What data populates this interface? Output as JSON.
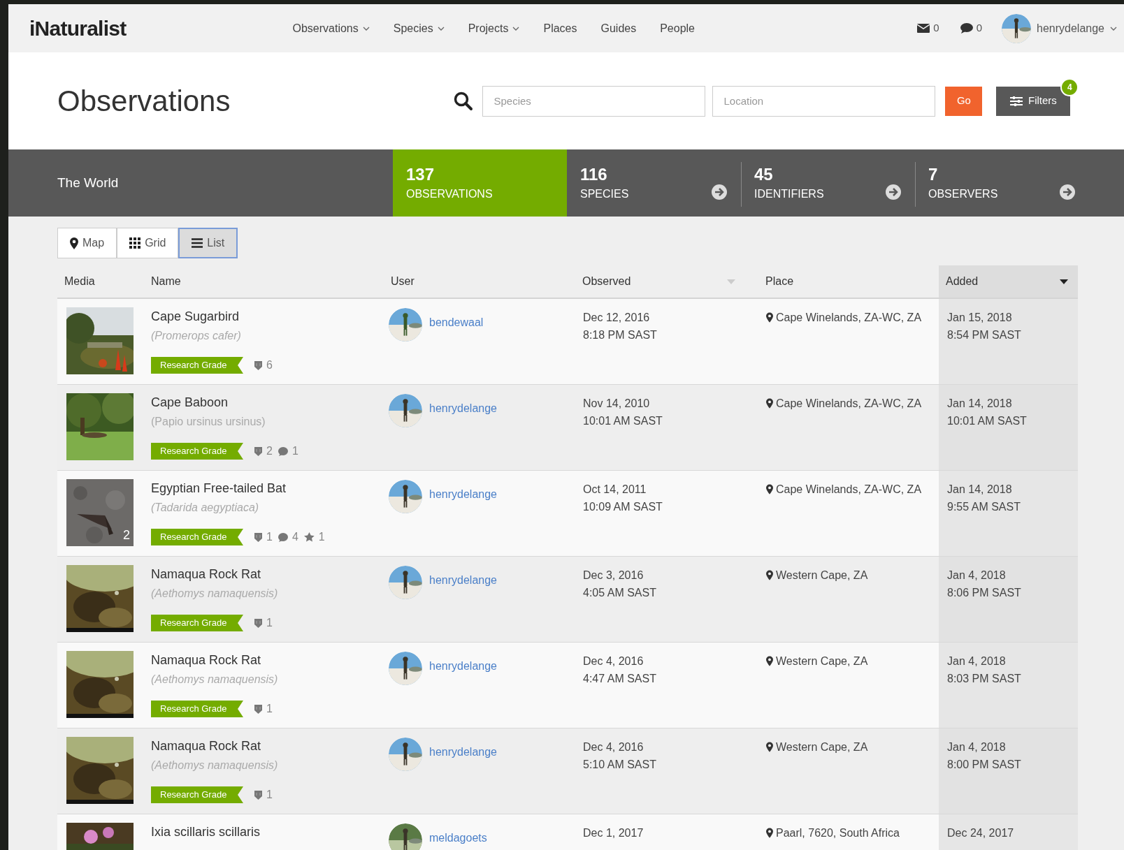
{
  "nav": {
    "logo": "iNaturalist",
    "items": [
      {
        "label": "Observations",
        "dropdown": true
      },
      {
        "label": "Species",
        "dropdown": true
      },
      {
        "label": "Projects",
        "dropdown": true
      },
      {
        "label": "Places",
        "dropdown": false
      },
      {
        "label": "Guides",
        "dropdown": false
      },
      {
        "label": "People",
        "dropdown": false
      }
    ],
    "messages": "0",
    "notifications": "0",
    "user": "henrydelange"
  },
  "header": {
    "title": "Observations",
    "species_placeholder": "Species",
    "location_placeholder": "Location",
    "go": "Go",
    "filters": "Filters",
    "filters_count": "4"
  },
  "stats": {
    "place": "The World",
    "tabs": [
      {
        "count": "137",
        "label": "OBSERVATIONS",
        "selected": true
      },
      {
        "count": "116",
        "label": "SPECIES",
        "selected": false
      },
      {
        "count": "45",
        "label": "IDENTIFIERS",
        "selected": false
      },
      {
        "count": "7",
        "label": "OBSERVERS",
        "selected": false
      }
    ]
  },
  "view_toggle": [
    {
      "label": "Map",
      "kind": "map",
      "selected": false
    },
    {
      "label": "Grid",
      "kind": "grid",
      "selected": false
    },
    {
      "label": "List",
      "kind": "list",
      "selected": true
    }
  ],
  "table": {
    "columns": [
      {
        "label": "Media",
        "sortable": false,
        "selected": false
      },
      {
        "label": "Name",
        "sortable": false,
        "selected": false
      },
      {
        "label": "User",
        "sortable": false,
        "selected": false
      },
      {
        "label": "Observed",
        "sortable": true,
        "selected": false
      },
      {
        "label": "Place",
        "sortable": false,
        "selected": false
      },
      {
        "label": "Added",
        "sortable": true,
        "selected": true
      }
    ],
    "rows": [
      {
        "name": "Cape Sugarbird",
        "scientific": "(Promerops cafer)",
        "italic": true,
        "quality": "Research Grade",
        "counts": [
          {
            "kind": "ids",
            "value": "6"
          }
        ],
        "user": "bendewaal",
        "observed_date": "Dec 12, 2016",
        "observed_time": "8:18 PM SAST",
        "place": "Cape Winelands, ZA-WC, ZA",
        "added_date": "Jan 15, 2018",
        "added_time": "8:54 PM SAST"
      },
      {
        "name": "Cape Baboon",
        "scientific": "(Papio ursinus ursinus)",
        "italic": false,
        "quality": "Research Grade",
        "counts": [
          {
            "kind": "ids",
            "value": "2"
          },
          {
            "kind": "comments",
            "value": "1"
          }
        ],
        "user": "henrydelange",
        "observed_date": "Nov 14, 2010",
        "observed_time": "10:01 AM SAST",
        "place": "Cape Winelands, ZA-WC, ZA",
        "added_date": "Jan 14, 2018",
        "added_time": "10:01 AM SAST"
      },
      {
        "name": "Egyptian Free-tailed Bat",
        "scientific": "(Tadarida aegyptiaca)",
        "italic": true,
        "photos": "2",
        "quality": "Research Grade",
        "counts": [
          {
            "kind": "ids",
            "value": "1"
          },
          {
            "kind": "comments",
            "value": "4"
          },
          {
            "kind": "faves",
            "value": "1"
          }
        ],
        "user": "henrydelange",
        "observed_date": "Oct 14, 2011",
        "observed_time": "10:09 AM SAST",
        "place": "Cape Winelands, ZA-WC, ZA",
        "added_date": "Jan 14, 2018",
        "added_time": "9:55 AM SAST"
      },
      {
        "name": "Namaqua Rock Rat",
        "scientific": "(Aethomys namaquensis)",
        "italic": true,
        "quality": "Research Grade",
        "counts": [
          {
            "kind": "ids",
            "value": "1"
          }
        ],
        "user": "henrydelange",
        "observed_date": "Dec 3, 2016",
        "observed_time": "4:05 AM SAST",
        "place": "Western Cape, ZA",
        "added_date": "Jan 4, 2018",
        "added_time": "8:06 PM SAST"
      },
      {
        "name": "Namaqua Rock Rat",
        "scientific": "(Aethomys namaquensis)",
        "italic": true,
        "quality": "Research Grade",
        "counts": [
          {
            "kind": "ids",
            "value": "1"
          }
        ],
        "user": "henrydelange",
        "observed_date": "Dec 4, 2016",
        "observed_time": "4:47 AM SAST",
        "place": "Western Cape, ZA",
        "added_date": "Jan 4, 2018",
        "added_time": "8:03 PM SAST"
      },
      {
        "name": "Namaqua Rock Rat",
        "scientific": "(Aethomys namaquensis)",
        "italic": true,
        "quality": "Research Grade",
        "counts": [
          {
            "kind": "ids",
            "value": "1"
          }
        ],
        "user": "henrydelange",
        "observed_date": "Dec 4, 2016",
        "observed_time": "5:10 AM SAST",
        "place": "Western Cape, ZA",
        "added_date": "Jan 4, 2018",
        "added_time": "8:00 PM SAST"
      },
      {
        "name": "Ixia scillaris scillaris",
        "user": "meldagoets",
        "observed_date": "Dec 1, 2017",
        "place": "Paarl, 7620, South Africa",
        "added_date": "Dec 24, 2017"
      }
    ]
  }
}
